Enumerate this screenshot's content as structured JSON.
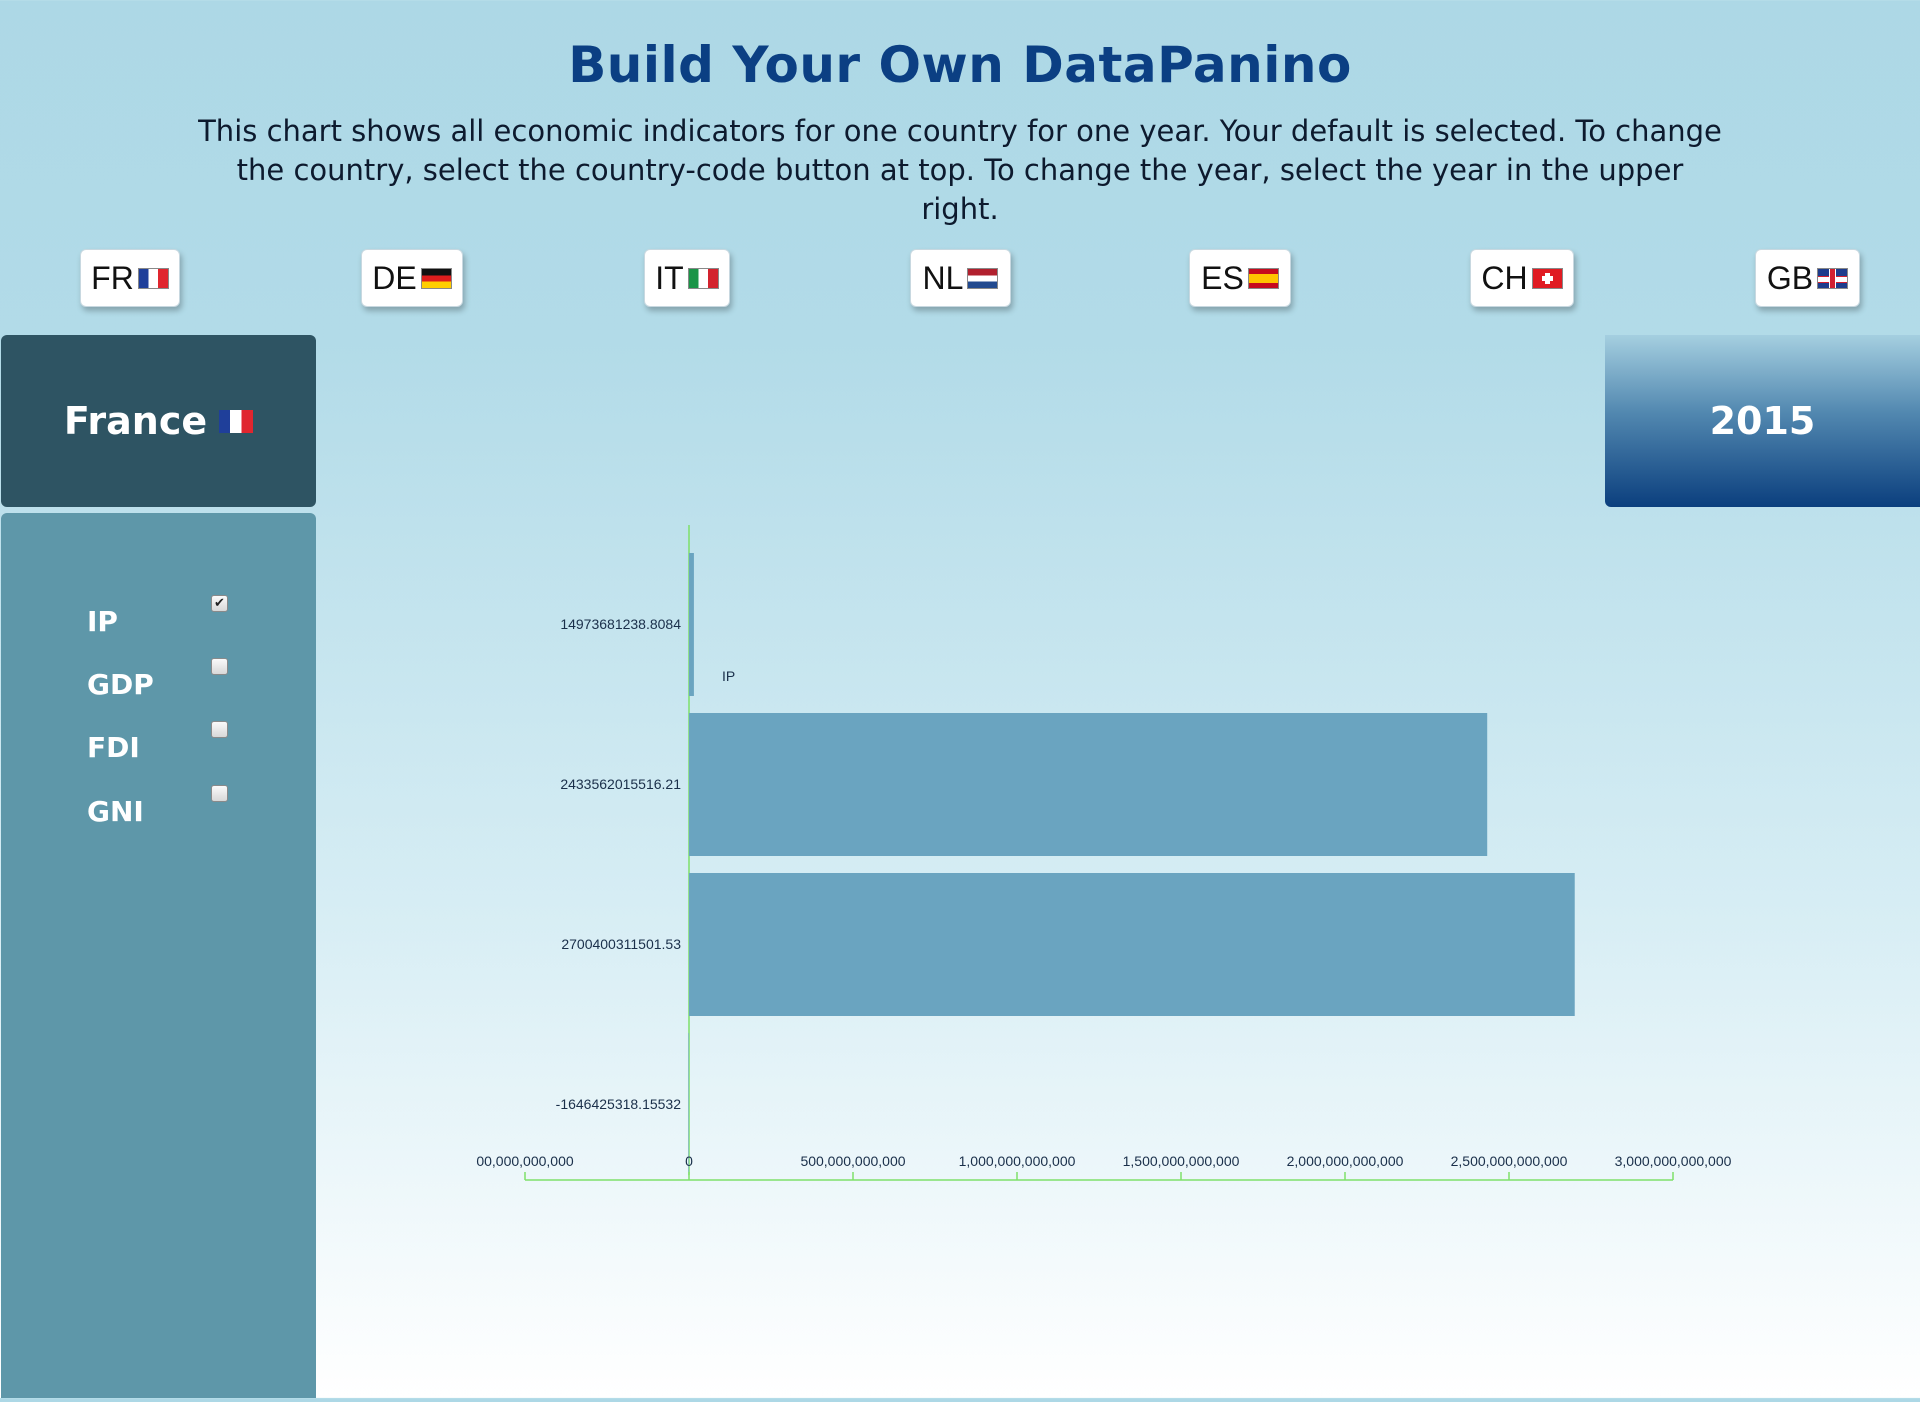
{
  "header": {
    "title": "Build Your Own DataPanino",
    "description": "This chart shows all economic indicators for one country for one year. Your default is selected. To change the country, select the country-code button at top. To change the year, select the year in the upper right."
  },
  "countries": [
    {
      "code": "FR",
      "flag": "flag-fr-icon"
    },
    {
      "code": "DE",
      "flag": "flag-de-icon"
    },
    {
      "code": "IT",
      "flag": "flag-it-icon"
    },
    {
      "code": "NL",
      "flag": "flag-nl-icon"
    },
    {
      "code": "ES",
      "flag": "flag-es-icon"
    },
    {
      "code": "CH",
      "flag": "flag-ch-icon"
    },
    {
      "code": "GB",
      "flag": "flag-gb-icon"
    }
  ],
  "selected_country": {
    "name": "France",
    "flag": "flag-fr-icon"
  },
  "selected_year": "2015",
  "indicators": [
    {
      "label": "IP",
      "checked": true
    },
    {
      "label": "GDP",
      "checked": false
    },
    {
      "label": "FDI",
      "checked": false
    },
    {
      "label": "GNI",
      "checked": false
    }
  ],
  "colors": {
    "bar": "#6aa4c0",
    "axis": "#7ee06a",
    "title": "#0b3f83",
    "country_panel": "#2e5463",
    "sidebar": "#5e97a9"
  },
  "chart_data": {
    "type": "bar",
    "orientation": "horizontal",
    "categories": [
      "14973681238.8084",
      "2433562015516.21",
      "2700400311501.53",
      "-1646425318.15532"
    ],
    "values": [
      14973681238.8084,
      2433562015516.21,
      2700400311501.53,
      -1646425318.15532
    ],
    "annotations": [
      {
        "text": "IP",
        "category_index": 0
      }
    ],
    "xlim": [
      -500000000000,
      3000000000000
    ],
    "xticks": [
      -500000000000,
      0,
      500000000000,
      1000000000000,
      1500000000000,
      2000000000000,
      2500000000000,
      3000000000000
    ],
    "xtick_labels": [
      "00,000,000,000",
      "0",
      "500,000,000,000",
      "1,000,000,000,000",
      "1,500,000,000,000",
      "2,000,000,000,000",
      "2,500,000,000,000",
      "3,000,000,000,000"
    ],
    "grid": false
  }
}
